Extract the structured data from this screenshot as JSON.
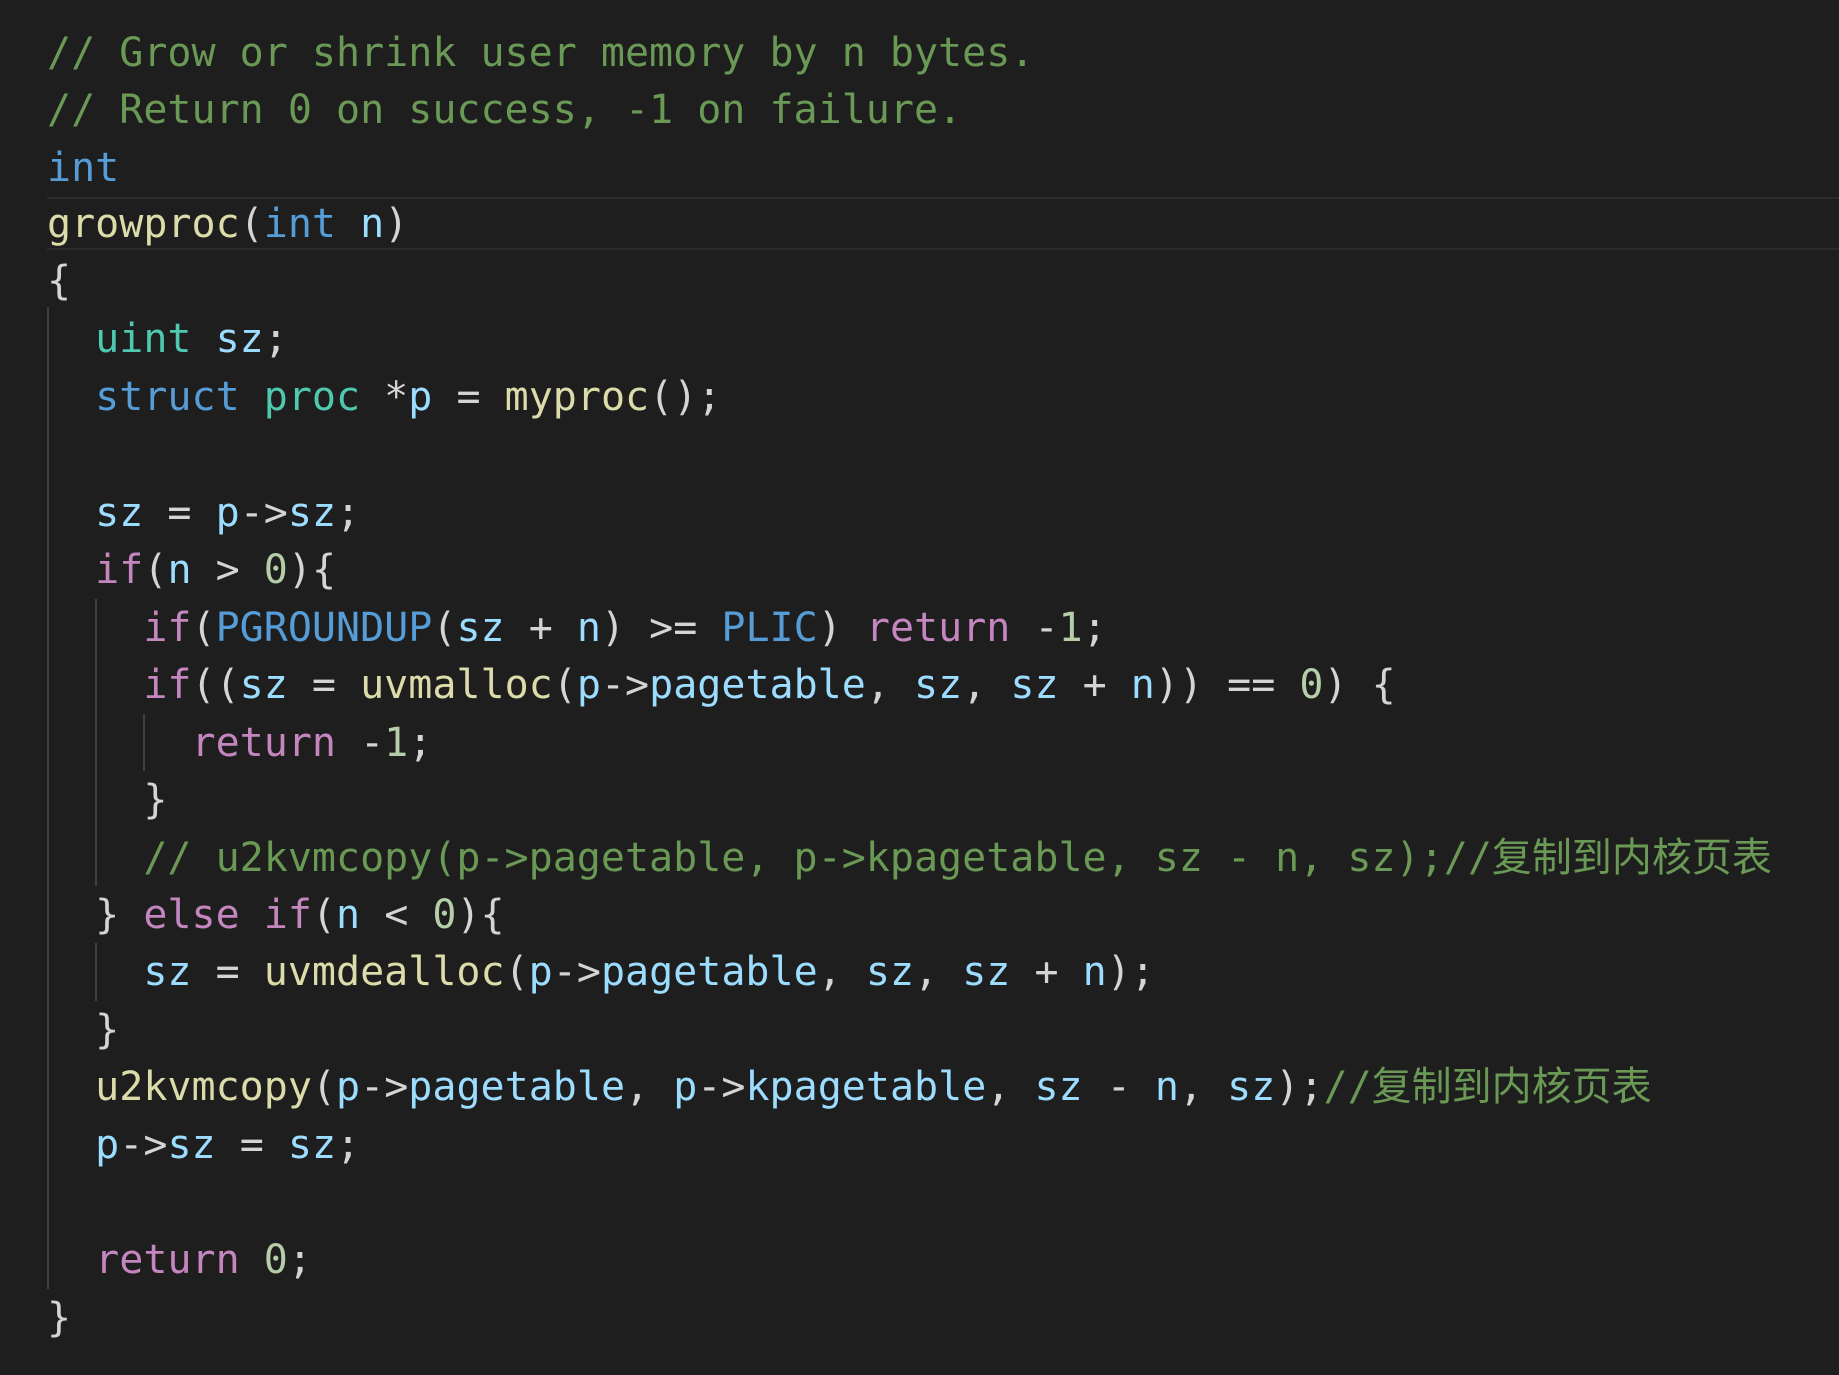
{
  "editor": {
    "language": "c",
    "theme_colors": {
      "background": "#1e1e1e",
      "comment": "#6a9955",
      "keyword": "#569cd6",
      "control": "#c586c0",
      "type": "#4ec9b0",
      "function": "#dcdcaa",
      "variable": "#9cdcfe",
      "number": "#b5cea8",
      "punctuation": "#d4d4d4"
    },
    "lines": [
      [
        {
          "t": "// Grow or shrink user memory by n bytes.",
          "c": "comment"
        }
      ],
      [
        {
          "t": "// Return 0 on success, -1 on failure.",
          "c": "comment"
        }
      ],
      [
        {
          "t": "int",
          "c": "keyword"
        }
      ],
      [
        {
          "t": "growproc",
          "c": "func"
        },
        {
          "t": "(",
          "c": "punct"
        },
        {
          "t": "int",
          "c": "keyword"
        },
        {
          "t": " ",
          "c": "punct"
        },
        {
          "t": "n",
          "c": "var"
        },
        {
          "t": ")",
          "c": "punct"
        }
      ],
      [
        {
          "t": "{",
          "c": "punct"
        }
      ],
      [
        {
          "t": "  ",
          "c": "punct"
        },
        {
          "t": "uint",
          "c": "type"
        },
        {
          "t": " ",
          "c": "punct"
        },
        {
          "t": "sz",
          "c": "var"
        },
        {
          "t": ";",
          "c": "punct"
        }
      ],
      [
        {
          "t": "  ",
          "c": "punct"
        },
        {
          "t": "struct",
          "c": "keyword"
        },
        {
          "t": " ",
          "c": "punct"
        },
        {
          "t": "proc",
          "c": "type"
        },
        {
          "t": " *",
          "c": "punct"
        },
        {
          "t": "p",
          "c": "var"
        },
        {
          "t": " = ",
          "c": "punct"
        },
        {
          "t": "myproc",
          "c": "func"
        },
        {
          "t": "();",
          "c": "punct"
        }
      ],
      [],
      [
        {
          "t": "  ",
          "c": "punct"
        },
        {
          "t": "sz",
          "c": "var"
        },
        {
          "t": " = ",
          "c": "punct"
        },
        {
          "t": "p",
          "c": "var"
        },
        {
          "t": "->",
          "c": "punct"
        },
        {
          "t": "sz",
          "c": "var"
        },
        {
          "t": ";",
          "c": "punct"
        }
      ],
      [
        {
          "t": "  ",
          "c": "punct"
        },
        {
          "t": "if",
          "c": "control"
        },
        {
          "t": "(",
          "c": "punct"
        },
        {
          "t": "n",
          "c": "var"
        },
        {
          "t": " > ",
          "c": "punct"
        },
        {
          "t": "0",
          "c": "num"
        },
        {
          "t": "){",
          "c": "punct"
        }
      ],
      [
        {
          "t": "    ",
          "c": "punct"
        },
        {
          "t": "if",
          "c": "control"
        },
        {
          "t": "(",
          "c": "punct"
        },
        {
          "t": "PGROUNDUP",
          "c": "macro"
        },
        {
          "t": "(",
          "c": "punct"
        },
        {
          "t": "sz",
          "c": "var"
        },
        {
          "t": " + ",
          "c": "punct"
        },
        {
          "t": "n",
          "c": "var"
        },
        {
          "t": ") >= ",
          "c": "punct"
        },
        {
          "t": "PLIC",
          "c": "macro"
        },
        {
          "t": ") ",
          "c": "punct"
        },
        {
          "t": "return",
          "c": "control"
        },
        {
          "t": " -",
          "c": "punct"
        },
        {
          "t": "1",
          "c": "num"
        },
        {
          "t": ";",
          "c": "punct"
        }
      ],
      [
        {
          "t": "    ",
          "c": "punct"
        },
        {
          "t": "if",
          "c": "control"
        },
        {
          "t": "((",
          "c": "punct"
        },
        {
          "t": "sz",
          "c": "var"
        },
        {
          "t": " = ",
          "c": "punct"
        },
        {
          "t": "uvmalloc",
          "c": "func"
        },
        {
          "t": "(",
          "c": "punct"
        },
        {
          "t": "p",
          "c": "var"
        },
        {
          "t": "->",
          "c": "punct"
        },
        {
          "t": "pagetable",
          "c": "var"
        },
        {
          "t": ", ",
          "c": "punct"
        },
        {
          "t": "sz",
          "c": "var"
        },
        {
          "t": ", ",
          "c": "punct"
        },
        {
          "t": "sz",
          "c": "var"
        },
        {
          "t": " + ",
          "c": "punct"
        },
        {
          "t": "n",
          "c": "var"
        },
        {
          "t": ")) == ",
          "c": "punct"
        },
        {
          "t": "0",
          "c": "num"
        },
        {
          "t": ") {",
          "c": "punct"
        }
      ],
      [
        {
          "t": "      ",
          "c": "punct"
        },
        {
          "t": "return",
          "c": "control"
        },
        {
          "t": " -",
          "c": "punct"
        },
        {
          "t": "1",
          "c": "num"
        },
        {
          "t": ";",
          "c": "punct"
        }
      ],
      [
        {
          "t": "    }",
          "c": "punct"
        }
      ],
      [
        {
          "t": "    ",
          "c": "punct"
        },
        {
          "t": "// u2kvmcopy(p->pagetable, p->kpagetable, sz - n, sz);//复制到内核页表",
          "c": "comment"
        }
      ],
      [
        {
          "t": "  } ",
          "c": "punct"
        },
        {
          "t": "else",
          "c": "control"
        },
        {
          "t": " ",
          "c": "punct"
        },
        {
          "t": "if",
          "c": "control"
        },
        {
          "t": "(",
          "c": "punct"
        },
        {
          "t": "n",
          "c": "var"
        },
        {
          "t": " < ",
          "c": "punct"
        },
        {
          "t": "0",
          "c": "num"
        },
        {
          "t": "){",
          "c": "punct"
        }
      ],
      [
        {
          "t": "    ",
          "c": "punct"
        },
        {
          "t": "sz",
          "c": "var"
        },
        {
          "t": " = ",
          "c": "punct"
        },
        {
          "t": "uvmdealloc",
          "c": "func"
        },
        {
          "t": "(",
          "c": "punct"
        },
        {
          "t": "p",
          "c": "var"
        },
        {
          "t": "->",
          "c": "punct"
        },
        {
          "t": "pagetable",
          "c": "var"
        },
        {
          "t": ", ",
          "c": "punct"
        },
        {
          "t": "sz",
          "c": "var"
        },
        {
          "t": ", ",
          "c": "punct"
        },
        {
          "t": "sz",
          "c": "var"
        },
        {
          "t": " + ",
          "c": "punct"
        },
        {
          "t": "n",
          "c": "var"
        },
        {
          "t": ");",
          "c": "punct"
        }
      ],
      [
        {
          "t": "  }",
          "c": "punct"
        }
      ],
      [
        {
          "t": "  ",
          "c": "punct"
        },
        {
          "t": "u2kvmcopy",
          "c": "func"
        },
        {
          "t": "(",
          "c": "punct"
        },
        {
          "t": "p",
          "c": "var"
        },
        {
          "t": "->",
          "c": "punct"
        },
        {
          "t": "pagetable",
          "c": "var"
        },
        {
          "t": ", ",
          "c": "punct"
        },
        {
          "t": "p",
          "c": "var"
        },
        {
          "t": "->",
          "c": "punct"
        },
        {
          "t": "kpagetable",
          "c": "var"
        },
        {
          "t": ", ",
          "c": "punct"
        },
        {
          "t": "sz",
          "c": "var"
        },
        {
          "t": " - ",
          "c": "punct"
        },
        {
          "t": "n",
          "c": "var"
        },
        {
          "t": ", ",
          "c": "punct"
        },
        {
          "t": "sz",
          "c": "var"
        },
        {
          "t": ");",
          "c": "punct"
        },
        {
          "t": "//复制到内核页表",
          "c": "comment"
        }
      ],
      [
        {
          "t": "  ",
          "c": "punct"
        },
        {
          "t": "p",
          "c": "var"
        },
        {
          "t": "->",
          "c": "punct"
        },
        {
          "t": "sz",
          "c": "var"
        },
        {
          "t": " = ",
          "c": "punct"
        },
        {
          "t": "sz",
          "c": "var"
        },
        {
          "t": ";",
          "c": "punct"
        }
      ],
      [],
      [
        {
          "t": "  ",
          "c": "punct"
        },
        {
          "t": "return",
          "c": "control"
        },
        {
          "t": " ",
          "c": "punct"
        },
        {
          "t": "0",
          "c": "num"
        },
        {
          "t": ";",
          "c": "punct"
        }
      ],
      [
        {
          "t": "}",
          "c": "punct"
        }
      ]
    ]
  }
}
